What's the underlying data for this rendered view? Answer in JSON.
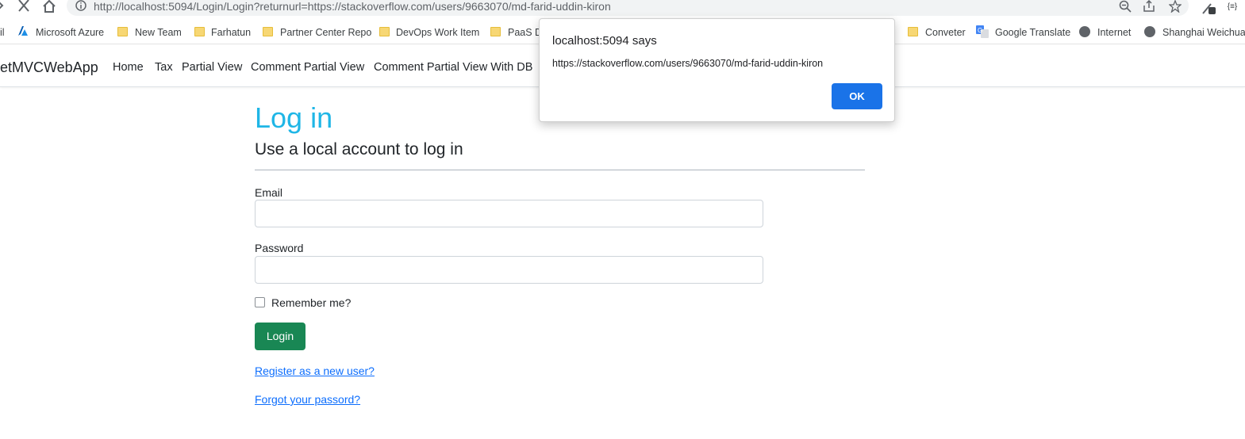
{
  "browser": {
    "url": "http://localhost:5094/Login/Login?returnurl=https://stackoverflow.com/users/9663070/md-farid-uddin-kiron"
  },
  "bookmarks": [
    {
      "label": "Microsoft Azure",
      "icon": "azure-icon"
    },
    {
      "label": "New Team",
      "icon": "folder-icon"
    },
    {
      "label": "Farhatun",
      "icon": "folder-icon"
    },
    {
      "label": "Partner Center Repo",
      "icon": "folder-icon"
    },
    {
      "label": "DevOps Work Item",
      "icon": "folder-icon"
    },
    {
      "label": "PaaS De",
      "icon": "folder-icon"
    },
    {
      "label": "Conveter",
      "icon": "folder-icon"
    },
    {
      "label": "Google Translate",
      "icon": "google-translate-icon"
    },
    {
      "label": "Internet",
      "icon": "globe-icon"
    },
    {
      "label": "Shanghai Weichuan",
      "icon": "globe-icon"
    }
  ],
  "bookmark_partial": "il",
  "navbar": {
    "brand": "etMVCWebApp",
    "links": [
      "Home",
      "Tax",
      "Partial View",
      "Comment Partial View",
      "Comment Partial View With DB"
    ]
  },
  "page": {
    "title": "Log in",
    "subtitle": "Use a local account to log in",
    "email_label": "Email",
    "email_value": "",
    "password_label": "Password",
    "password_value": "",
    "remember_label": "Remember me?",
    "login_button": "Login",
    "register_link": "Register as a new user?",
    "forgot_link": "Forgot your passord?"
  },
  "dialog": {
    "title": "localhost:5094 says",
    "message": "https://stackoverflow.com/users/9663070/md-farid-uddin-kiron",
    "ok_label": "OK"
  },
  "colors": {
    "title": "#1fb6e6",
    "login_button": "#198754",
    "link": "#0d6efd",
    "dialog_ok": "#1a73e8"
  }
}
